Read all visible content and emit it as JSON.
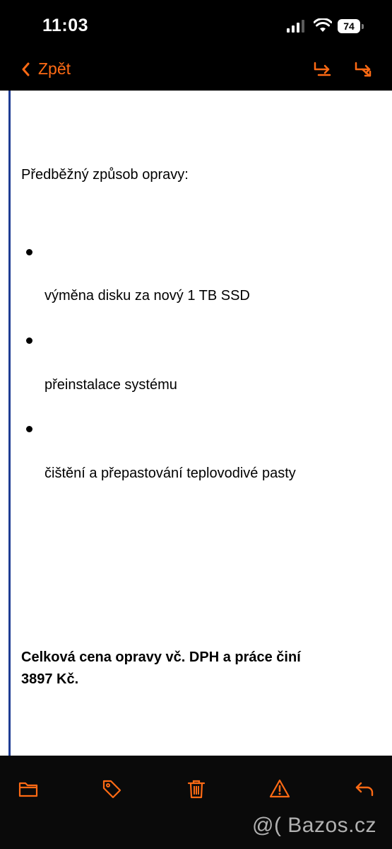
{
  "status_bar": {
    "time": "11:03",
    "battery_level": "74"
  },
  "nav": {
    "back_label": "Zpět"
  },
  "message": {
    "intro": "Předběžný způsob opravy:",
    "items": [
      "výměna disku za nový 1 TB SSD",
      "přeinstalace systému",
      "čištění a přepastování teplovodivé pasty"
    ],
    "total_line1": "Celková cena opravy vč. DPH a práce činí",
    "total_line2": "3897 Kč."
  },
  "toolbar": {
    "icons": [
      "folder-icon",
      "tag-icon",
      "trash-icon",
      "warning-icon",
      "reply-icon"
    ]
  },
  "watermark": "@( Bazos.cz",
  "colors": {
    "accent": "#ff6a14",
    "quote_bar": "#1f3c94"
  }
}
